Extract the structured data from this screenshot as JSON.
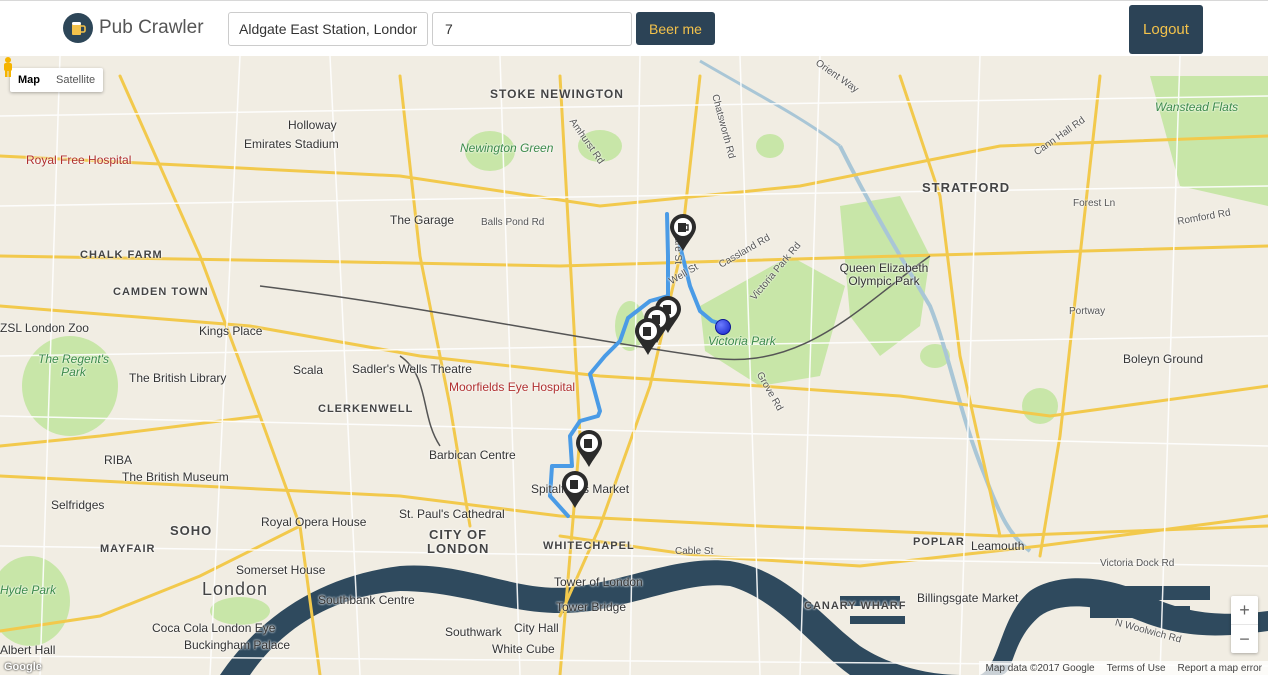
{
  "header": {
    "brand": "Pub Crawler",
    "location_value": "Aldgate East Station, London",
    "count_value": "7",
    "beer_button": "Beer me",
    "logout_button": "Logout"
  },
  "map": {
    "type_controls": {
      "map": "Map",
      "satellite": "Satellite"
    },
    "zoom_in": "+",
    "zoom_out": "−",
    "footer": {
      "data": "Map data ©2017 Google",
      "terms": "Terms of Use",
      "report": "Report a map error"
    },
    "watermark": "Google",
    "labels": {
      "stoke_newington": "STOKE NEWINGTON",
      "holloway": "Holloway",
      "emirates": "Emirates Stadium",
      "royal_free": "Royal Free Hospital",
      "newington_green": "Newington Green",
      "stratford": "STRATFORD",
      "wanstead": "Wanstead Flats",
      "chalk_farm": "CHALK FARM",
      "camden": "CAMDEN TOWN",
      "the_garage": "The Garage",
      "qe_olympic": "Queen Elizabeth Olympic Park",
      "zsl": "ZSL London Zoo",
      "kings_place": "Kings Place",
      "regents_park": "The Regent's Park",
      "british_library": "The British Library",
      "scala": "Scala",
      "sadlers": "Sadler's Wells Theatre",
      "moorfields": "Moorfields Eye Hospital",
      "victoria_park": "Victoria Park",
      "boleyn": "Boleyn Ground",
      "clerkenwell": "CLERKENWELL",
      "barbican": "Barbican Centre",
      "riba": "RIBA",
      "british_museum": "The British Museum",
      "spitalfields": "Spitalfields Market",
      "selfridges": "Selfridges",
      "soho": "SOHO",
      "royal_opera": "Royal Opera House",
      "st_pauls": "St. Paul's Cathedral",
      "city_of_london": "CITY OF LONDON",
      "whitechapel": "WHITECHAPEL",
      "mayfair": "MAYFAIR",
      "poplar": "POPLAR",
      "leamouth": "Leamouth",
      "somerset": "Somerset House",
      "london": "London",
      "southbank": "Southbank Centre",
      "tower_of_london": "Tower of London",
      "tower_bridge": "Tower Bridge",
      "canary_wharf": "CANARY WHARF",
      "billingsgate": "Billingsgate Market",
      "hyde_park": "Hyde Park",
      "albert_hall": "Albert Hall",
      "coca_cola": "Coca Cola London Eye",
      "buckingham": "Buckingham Palace",
      "southwark": "Southwark",
      "city_hall": "City Hall",
      "white_cube": "White Cube",
      "victoria_dock": "Victoria Dock Rd",
      "n_woolwich": "N Woolwich Rd",
      "balls_pond": "Balls Pond Rd",
      "cassland": "Cassland Rd",
      "victoria_park_rd": "Victoria Park Rd",
      "grove_rd": "Grove Rd",
      "forest_ln": "Forest Ln",
      "romford": "Romford Rd",
      "portway": "Portway",
      "cable_st": "Cable St",
      "well_st": "Well St",
      "mare_st": "Mare St",
      "chatsworth": "Chatsworth Rd",
      "amhurst": "Amhurst Rd",
      "orient_way": "Orient Way",
      "camn_hall": "Cann Hall Rd"
    },
    "colors": {
      "route": "#4a9be6",
      "marker": "#2b2b2b",
      "origin": "#1a2ad8",
      "river": "#2f4a5e"
    }
  }
}
